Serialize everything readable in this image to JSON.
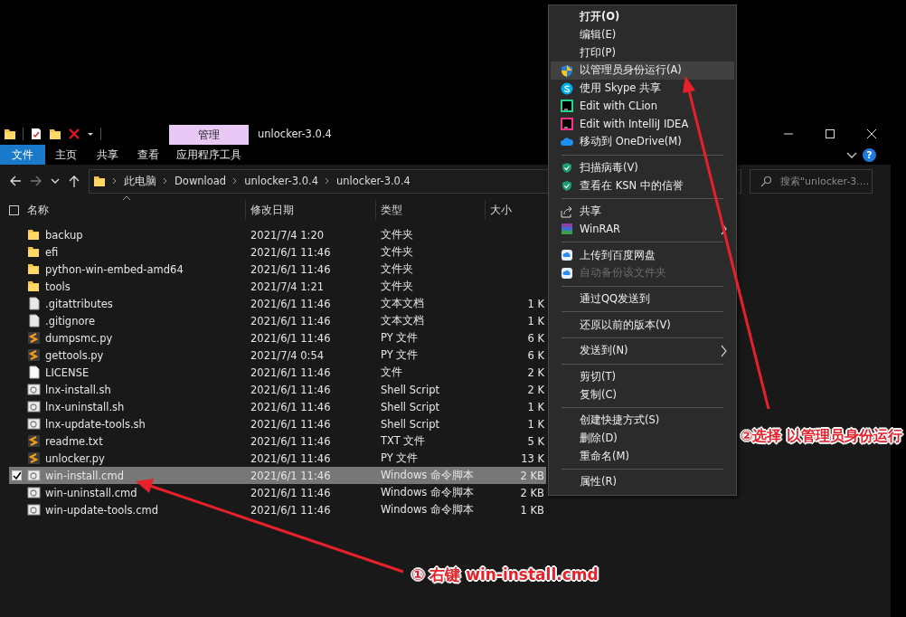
{
  "window": {
    "title": "unlocker-3.0.4",
    "context_tab": "管理"
  },
  "ribbon": {
    "tabs": [
      {
        "label": "文件",
        "selected": true
      },
      {
        "label": "主页",
        "selected": false
      },
      {
        "label": "共享",
        "selected": false
      },
      {
        "label": "查看",
        "selected": false
      },
      {
        "label": "应用程序工具",
        "selected": false
      }
    ],
    "help": "?"
  },
  "address": {
    "path": [
      "此电脑",
      "Download",
      "unlocker-3.0.4",
      "unlocker-3.0.4"
    ]
  },
  "search": {
    "placeholder": "搜索\"unlocker-3...."
  },
  "table": {
    "header_checked": false,
    "columns": [
      "名称",
      "修改日期",
      "类型",
      "大小"
    ],
    "rows": [
      {
        "name": "backup",
        "date": "2021/7/4 1:20",
        "type": "文件夹",
        "selected": false
      },
      {
        "name": "efi",
        "date": "2021/6/1 11:46",
        "type": "文件夹",
        "selected": false
      },
      {
        "name": "python-win-embed-amd64",
        "date": "2021/6/1 11:46",
        "type": "文件夹",
        "selected": false
      },
      {
        "name": "tools",
        "date": "2021/7/4 1:21",
        "type": "文件夹",
        "selected": false
      },
      {
        "name": ".gitattributes",
        "date": "2021/6/1 11:46",
        "type": "文本文档",
        "size": "1 K",
        "selected": false
      },
      {
        "name": ".gitignore",
        "date": "2021/6/1 11:46",
        "type": "文本文档",
        "size": "1 K",
        "selected": false
      },
      {
        "name": "dumpsmc.py",
        "date": "2021/6/1 11:46",
        "type": "PY 文件",
        "size": "6 K",
        "selected": false
      },
      {
        "name": "gettools.py",
        "date": "2021/7/4 0:54",
        "type": "PY 文件",
        "size": "6 K",
        "selected": false
      },
      {
        "name": "LICENSE",
        "date": "2021/6/1 11:46",
        "type": "文件",
        "size": "2 K",
        "selected": false
      },
      {
        "name": "lnx-install.sh",
        "date": "2021/6/1 11:46",
        "type": "Shell Script",
        "size": "2 K",
        "selected": false
      },
      {
        "name": "lnx-uninstall.sh",
        "date": "2021/6/1 11:46",
        "type": "Shell Script",
        "size": "1 K",
        "selected": false
      },
      {
        "name": "lnx-update-tools.sh",
        "date": "2021/6/1 11:46",
        "type": "Shell Script",
        "size": "1 K",
        "selected": false
      },
      {
        "name": "readme.txt",
        "date": "2021/6/1 11:46",
        "type": "TXT 文件",
        "size": "5 K",
        "selected": false
      },
      {
        "name": "unlocker.py",
        "date": "2021/6/1 11:46",
        "type": "PY 文件",
        "size": "13 K",
        "selected": false
      },
      {
        "name": "win-install.cmd",
        "date": "2021/6/1 11:46",
        "type": "Windows 命令脚本",
        "size": "2 KB",
        "selected": true
      },
      {
        "name": "win-uninstall.cmd",
        "date": "2021/6/1 11:46",
        "type": "Windows 命令脚本",
        "size": "2 KB",
        "selected": false
      },
      {
        "name": "win-update-tools.cmd",
        "date": "2021/6/1 11:46",
        "type": "Windows 命令脚本",
        "size": "1 KB",
        "selected": false
      }
    ]
  },
  "context_menu": {
    "groups": [
      [
        {
          "label": "打开(O)",
          "default": true,
          "selected": false,
          "disabled": false,
          "submenu": false
        },
        {
          "label": "编辑(E)",
          "default": false,
          "selected": false,
          "disabled": false,
          "submenu": false
        },
        {
          "label": "打印(P)",
          "default": false,
          "selected": false,
          "disabled": false,
          "submenu": false
        },
        {
          "label": "以管理员身份运行(A)",
          "default": false,
          "selected": true,
          "disabled": false,
          "submenu": false
        },
        {
          "label": "使用 Skype 共享",
          "default": false,
          "selected": false,
          "disabled": false,
          "submenu": false
        },
        {
          "label": "Edit with CLion",
          "default": false,
          "selected": false,
          "disabled": false,
          "submenu": false
        },
        {
          "label": "Edit with IntelliJ IDEA",
          "default": false,
          "selected": false,
          "disabled": false,
          "submenu": false
        },
        {
          "label": "移动到 OneDrive(M)",
          "default": false,
          "selected": false,
          "disabled": false,
          "submenu": false
        }
      ],
      [
        {
          "label": "扫描病毒(V)",
          "default": false,
          "selected": false,
          "disabled": false,
          "submenu": false
        },
        {
          "label": "查看在 KSN 中的信誉",
          "default": false,
          "selected": false,
          "disabled": false,
          "submenu": false
        }
      ],
      [
        {
          "label": "共享",
          "default": false,
          "selected": false,
          "disabled": false,
          "submenu": false
        },
        {
          "label": "WinRAR",
          "default": false,
          "selected": false,
          "disabled": false,
          "submenu": true
        }
      ],
      [
        {
          "label": "上传到百度网盘",
          "default": false,
          "selected": false,
          "disabled": false,
          "submenu": false
        },
        {
          "label": "自动备份该文件夹",
          "default": false,
          "selected": false,
          "disabled": true,
          "submenu": false
        }
      ],
      [
        {
          "label": "通过QQ发送到",
          "default": false,
          "selected": false,
          "disabled": false,
          "submenu": false
        }
      ],
      [
        {
          "label": "还原以前的版本(V)",
          "default": false,
          "selected": false,
          "disabled": false,
          "submenu": false
        }
      ],
      [
        {
          "label": "发送到(N)",
          "default": false,
          "selected": false,
          "disabled": false,
          "submenu": true
        }
      ],
      [
        {
          "label": "剪切(T)",
          "default": false,
          "selected": false,
          "disabled": false,
          "submenu": false
        },
        {
          "label": "复制(C)",
          "default": false,
          "selected": false,
          "disabled": false,
          "submenu": false
        }
      ],
      [
        {
          "label": "创建快捷方式(S)",
          "default": false,
          "selected": false,
          "disabled": false,
          "submenu": false
        },
        {
          "label": "删除(D)",
          "default": false,
          "selected": false,
          "disabled": false,
          "submenu": false
        },
        {
          "label": "重命名(M)",
          "default": false,
          "selected": false,
          "disabled": false,
          "submenu": false
        }
      ],
      [
        {
          "label": "属性(R)",
          "default": false,
          "selected": false,
          "disabled": false,
          "submenu": false
        }
      ]
    ]
  },
  "annotations": [
    {
      "text": "① 右键 win-install.cmd"
    },
    {
      "text": "②选择 以管理员身份运行"
    }
  ]
}
